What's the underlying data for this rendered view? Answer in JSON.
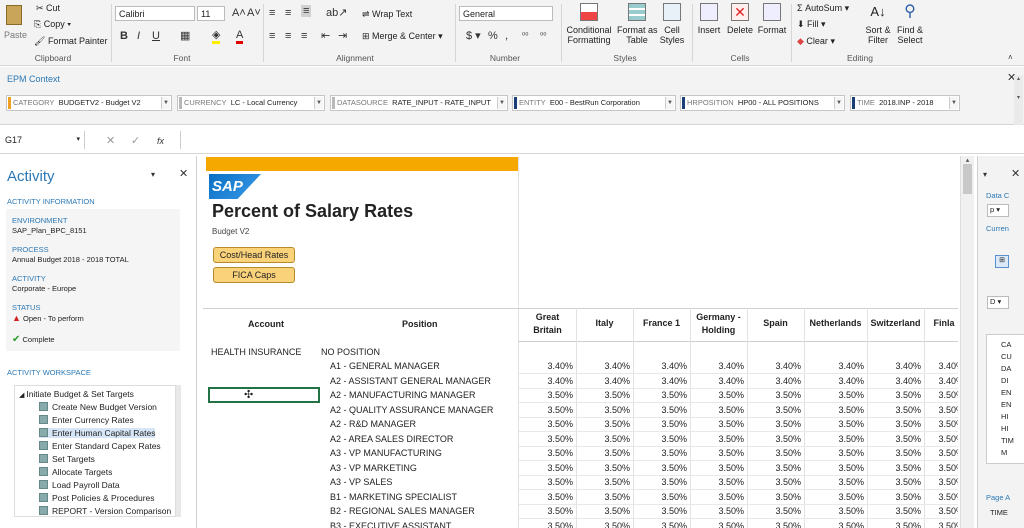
{
  "ribbon": {
    "clipboard": {
      "paste": "Paste",
      "cut": "Cut",
      "copy": "Copy",
      "format_painter": "Format Painter",
      "label": "Clipboard"
    },
    "font": {
      "name": "Calibri",
      "size": "11",
      "bold": "B",
      "italic": "I",
      "underline": "U",
      "label": "Font"
    },
    "alignment": {
      "wrap": "Wrap Text",
      "merge": "Merge & Center",
      "label": "Alignment"
    },
    "number": {
      "format": "General",
      "label": "Number"
    },
    "styles": {
      "conditional": "Conditional",
      "formatting": "Formatting",
      "format_as": "Format as",
      "table": "Table",
      "cell": "Cell",
      "cell_styles": "Styles",
      "label": "Styles"
    },
    "cells": {
      "insert": "Insert",
      "delete": "Delete",
      "format": "Format",
      "label": "Cells"
    },
    "editing": {
      "autosum": "AutoSum",
      "fill": "Fill",
      "clear": "Clear",
      "sort": "Sort &",
      "filter": "Filter",
      "find": "Find &",
      "select": "Select",
      "label": "Editing"
    }
  },
  "epm": {
    "title": "EPM Context",
    "contexts": [
      {
        "key": "CATEGORY",
        "value": "BUDGETV2 - Budget V2",
        "color": "#f0a020"
      },
      {
        "key": "CURRENCY",
        "value": "LC - Local Currency",
        "color": "#b8b8b8"
      },
      {
        "key": "DATASOURCE",
        "value": "RATE_INPUT - RATE_INPUT",
        "color": "#b8b8b8"
      },
      {
        "key": "ENTITY",
        "value": "E00 - BestRun Corporation",
        "color": "#1a3e78"
      },
      {
        "key": "HRPOSITION",
        "value": "HP00 - ALL POSITIONS",
        "color": "#1a3e78"
      },
      {
        "key": "TIME",
        "value": "2018.INP - 2018",
        "color": "#1a3e78"
      }
    ]
  },
  "formula_bar": {
    "cell_ref": "G17",
    "fx": "fx"
  },
  "activity": {
    "title": "Activity",
    "info_header": "ACTIVITY INFORMATION",
    "environment_label": "ENVIRONMENT",
    "environment": "SAP_Plan_BPC_8151",
    "process_label": "PROCESS",
    "process": "Annual Budget 2018 - 2018 TOTAL",
    "activity_label": "ACTIVITY",
    "activity": "Corporate - Europe",
    "status_label": "STATUS",
    "status": "Open - To perform",
    "complete": "Complete",
    "workspace_header": "ACTIVITY WORKSPACE",
    "workspace": {
      "root": "Initiate Budget & Set Targets",
      "items": [
        "Create New Budget Version",
        "Enter Currency Rates",
        "Enter Human Capital Rates",
        "Enter Standard Capex Rates",
        "Set Targets",
        "Allocate Targets",
        "Load Payroll Data",
        "Post Policies & Procedures",
        "REPORT - Version Comparison"
      ]
    }
  },
  "sheet": {
    "logo": "SAP",
    "title": "Percent of Salary Rates",
    "subtitle": "Budget V2",
    "btn_cost": "Cost/Head Rates",
    "btn_fica": "FICA Caps",
    "col_account": "Account",
    "col_position": "Position",
    "countries": [
      [
        "Great",
        "Britain"
      ],
      [
        "Italy",
        ""
      ],
      [
        "France 1",
        ""
      ],
      [
        "Germany -",
        "Holding"
      ],
      [
        "Spain",
        ""
      ],
      [
        "Netherlands",
        ""
      ],
      [
        "Switzerland",
        ""
      ],
      [
        "Finla",
        ""
      ]
    ],
    "account": "HEALTH INSURANCE",
    "no_position": "NO POSITION",
    "rows": [
      {
        "pos": "A1 - GENERAL MANAGER",
        "v": "3.40%"
      },
      {
        "pos": "A2 - ASSISTANT GENERAL MANAGER",
        "v": "3.40%"
      },
      {
        "pos": "A2 - MANUFACTURING MANAGER",
        "v": "3.50%"
      },
      {
        "pos": "A2 - QUALITY ASSURANCE MANAGER",
        "v": "3.50%"
      },
      {
        "pos": "A2 - R&D MANAGER",
        "v": "3.50%"
      },
      {
        "pos": "A2 - AREA SALES DIRECTOR",
        "v": "3.50%"
      },
      {
        "pos": "A3 - VP MANUFACTURING",
        "v": "3.50%"
      },
      {
        "pos": "A3 - VP MARKETING",
        "v": "3.50%"
      },
      {
        "pos": "A3 - VP SALES",
        "v": "3.50%"
      },
      {
        "pos": "B1 - MARKETING SPECIALIST",
        "v": "3.50%"
      },
      {
        "pos": "B2 - REGIONAL SALES MANAGER",
        "v": "3.50%"
      },
      {
        "pos": "B3 - EXECUTIVE ASSISTANT",
        "v": "3.50%"
      }
    ]
  },
  "right_panel": {
    "data": "Data C",
    "p": "p",
    "curr": "Curren",
    "d": "D",
    "page": "Page A",
    "time": "TIME",
    "list": [
      "CA",
      "CU",
      "DA",
      "DI",
      "EN",
      "EN",
      "HI",
      "HI",
      "TIM",
      "M"
    ]
  }
}
